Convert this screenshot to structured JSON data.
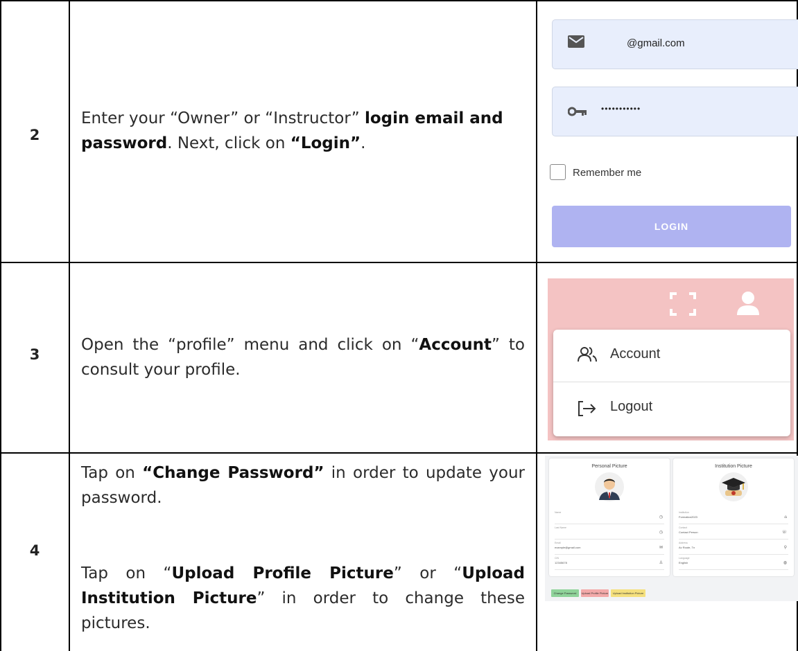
{
  "rows": [
    {
      "number": "2",
      "description": [
        {
          "text": "Enter your “Owner” or “Instructor” ",
          "bold": false
        },
        {
          "text": "login email and password",
          "bold": true
        },
        {
          "text": ". Next, click on ",
          "bold": false
        },
        {
          "text": "“Login”",
          "bold": true
        },
        {
          "text": ".",
          "bold": false
        }
      ]
    },
    {
      "number": "3",
      "description": [
        {
          "text": "Open the “profile” menu and click on “",
          "bold": false
        },
        {
          "text": "Account",
          "bold": true
        },
        {
          "text": "” to consult your profile.",
          "bold": false
        }
      ]
    },
    {
      "number": "4",
      "description_p1": [
        {
          "text": "Tap on ",
          "bold": false
        },
        {
          "text": "“Change Password”",
          "bold": true
        },
        {
          "text": " in order to update your password.",
          "bold": false
        }
      ],
      "description_p2": [
        {
          "text": "Tap on “",
          "bold": false
        },
        {
          "text": "Upload Profile Picture",
          "bold": true
        },
        {
          "text": "” or “",
          "bold": false
        },
        {
          "text": "Upload Institution Picture",
          "bold": true
        },
        {
          "text": "” in order to change these pictures.",
          "bold": false
        }
      ]
    }
  ],
  "login_mock": {
    "email_value": "@gmail.com",
    "password_value": "•••••••••••",
    "remember_label": "Remember me",
    "login_button": "LOGIN",
    "field_bg": "#e8eefc",
    "button_color": "#afb3f1"
  },
  "profile_menu_mock": {
    "bar_color": "#f4c3c3",
    "items": [
      {
        "label": "Account",
        "icon": "users-icon"
      },
      {
        "label": "Logout",
        "icon": "logout-icon"
      }
    ]
  },
  "profile_page_mock": {
    "personal_card_title": "Personal Picture",
    "institution_card_title": "Institution Picture",
    "personal_fields": [
      {
        "label": "Name",
        "value": ""
      },
      {
        "label": "Last Name",
        "value": ""
      },
      {
        "label": "Email",
        "value": "example@gmail.com"
      },
      {
        "label": "CIN",
        "value": "12345678"
      }
    ],
    "institution_fields": [
      {
        "label": "Institution",
        "value": "Formation2023"
      },
      {
        "label": "Contact",
        "value": "Contact Person"
      },
      {
        "label": "Address",
        "value": "Av Route, Tn"
      },
      {
        "label": "Language",
        "value": "English"
      }
    ],
    "buttons": [
      {
        "label": "Change Password",
        "color": "#8fd39a"
      },
      {
        "label": "Upload Profile Picture",
        "color": "#f3a9a9"
      },
      {
        "label": "Upload Institution Picture",
        "color": "#f5e07d"
      }
    ]
  }
}
